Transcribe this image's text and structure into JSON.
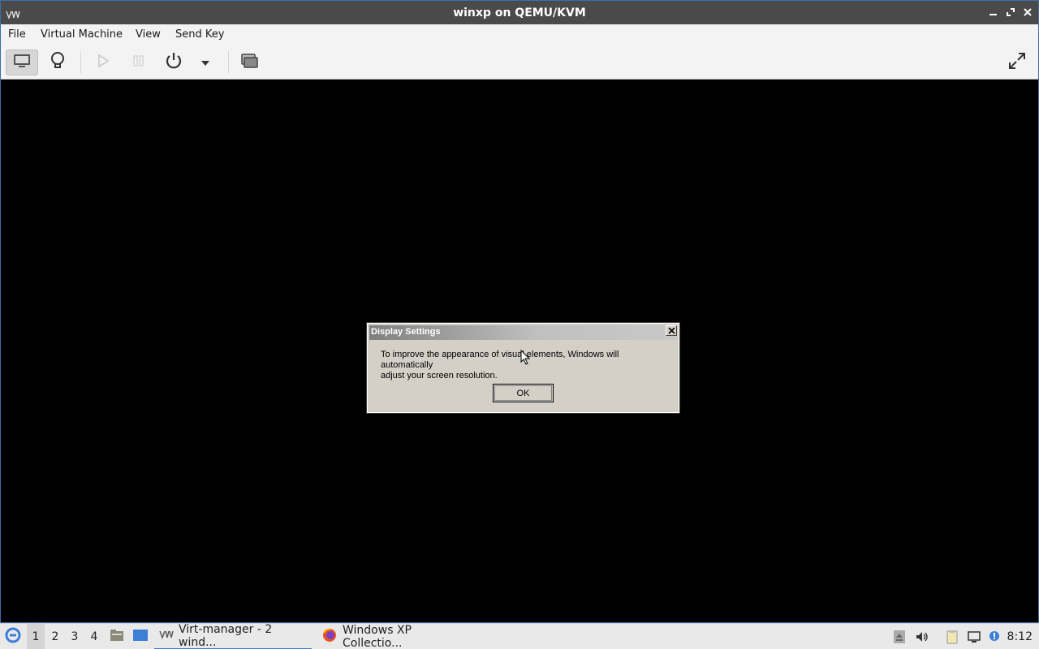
{
  "window": {
    "title": "winxp on QEMU/KVM"
  },
  "menubar": {
    "items": [
      "File",
      "Virtual Machine",
      "View",
      "Send Key"
    ]
  },
  "toolbar": {
    "buttons": [
      "console-icon",
      "details-lightbulb-icon",
      "run-icon",
      "pause-icon",
      "power-icon",
      "power-dropdown-icon",
      "snapshots-icon",
      "fullscreen-icon"
    ]
  },
  "dialog": {
    "title": "Display Settings",
    "message_line1": "To improve the appearance of visual elements, Windows will automatically",
    "message_line2": "adjust your screen resolution.",
    "ok_label": "OK"
  },
  "taskbar": {
    "workspaces": [
      "1",
      "2",
      "3",
      "4"
    ],
    "active_workspace": "1",
    "tasks": [
      {
        "label": "Virt-manager - 2 wind...",
        "icon": "virt-manager-icon",
        "active": true
      },
      {
        "label": "Windows XP Collectio...",
        "icon": "firefox-icon",
        "active": false
      }
    ],
    "clock": "8:12"
  },
  "colors": {
    "titlebar": "#4a4a4a",
    "accent": "#3d7fd6",
    "dialog_bg": "#d4d0c8"
  }
}
